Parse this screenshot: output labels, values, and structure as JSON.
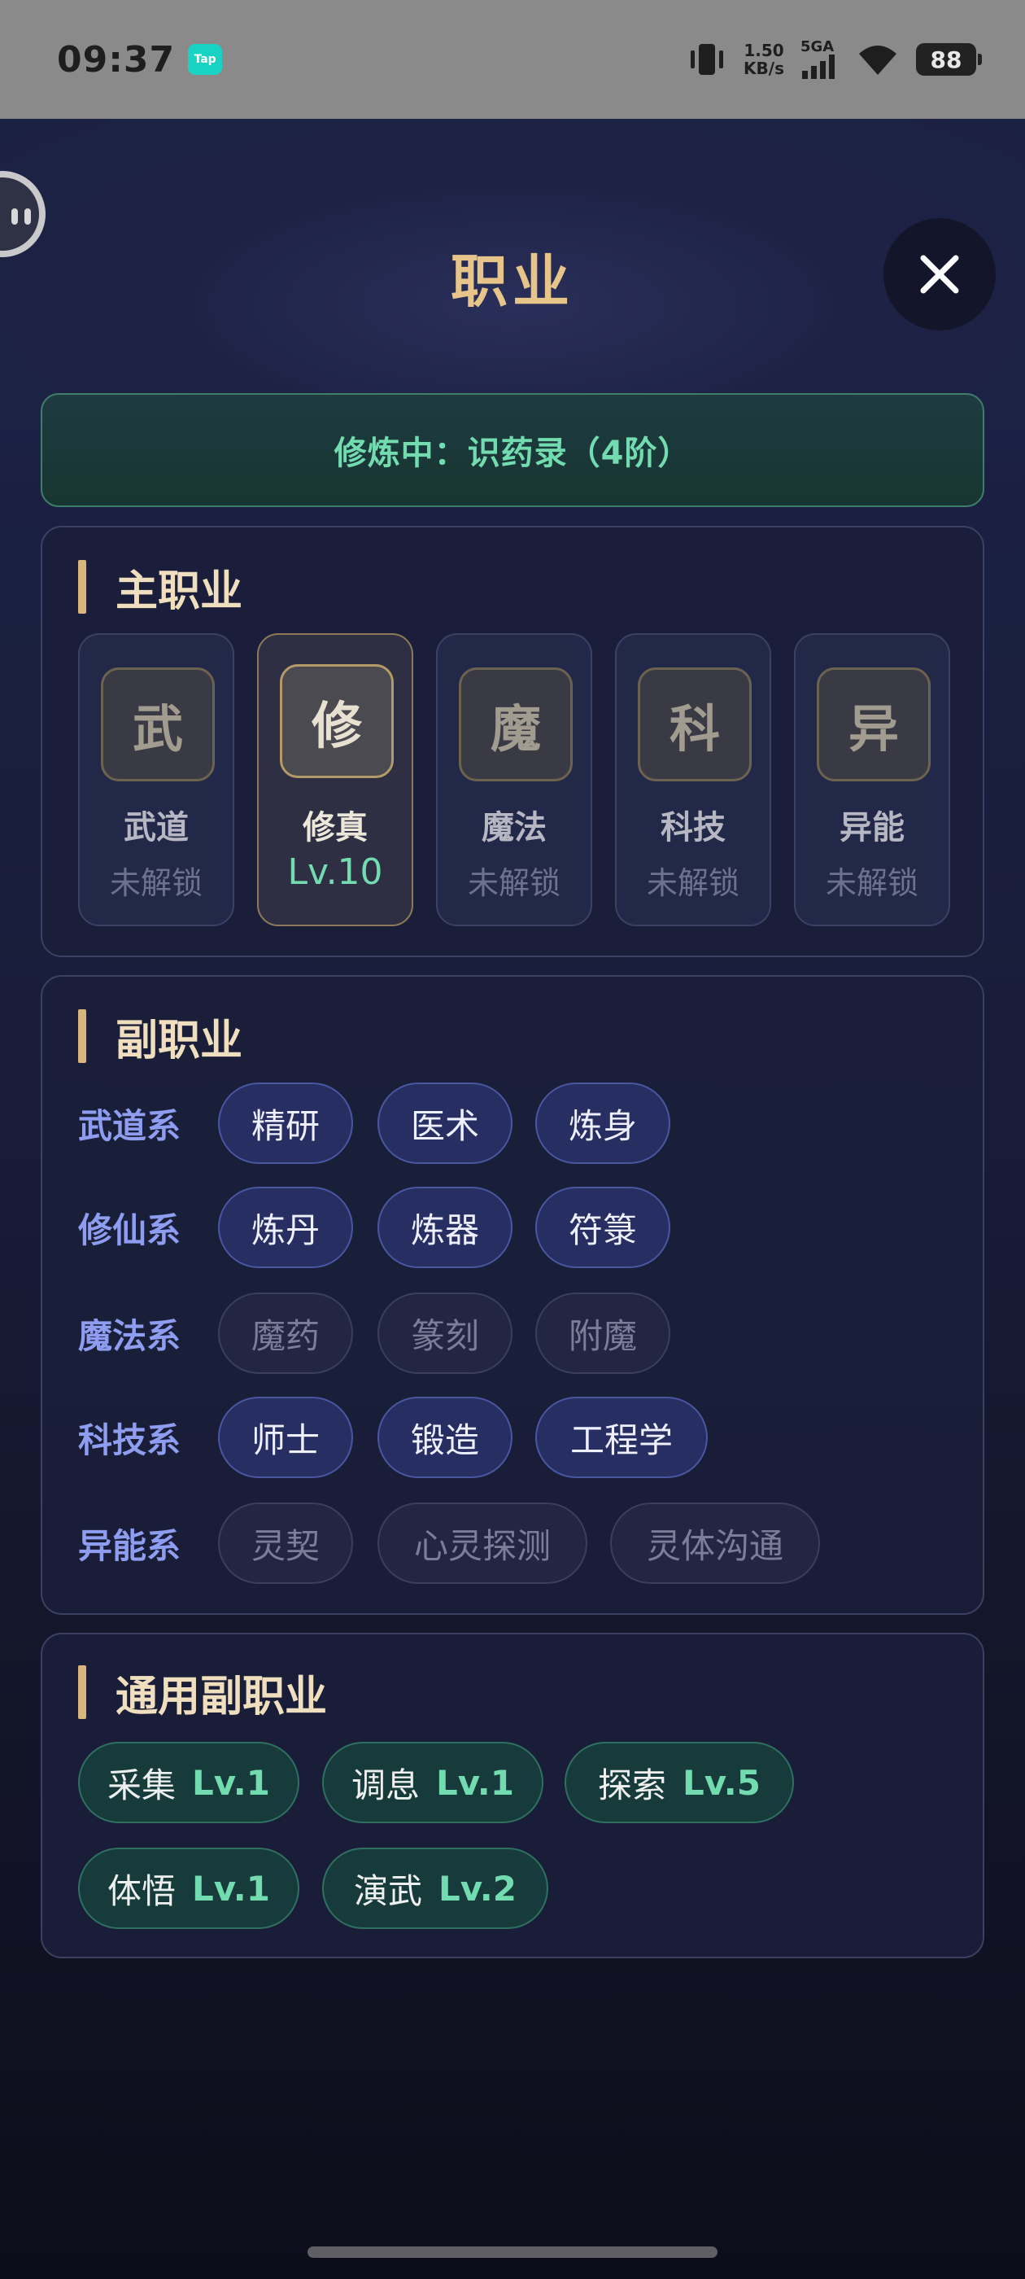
{
  "status_bar": {
    "time": "09:37",
    "app_badge": "Tap",
    "speed_value": "1.50",
    "speed_unit": "KB/s",
    "network": "5GA",
    "battery": "88"
  },
  "header": {
    "title": "职业"
  },
  "banner": {
    "text": "修炼中：识药录（4阶）"
  },
  "main_jobs": {
    "title": "主职业",
    "items": [
      {
        "icon": "武",
        "name": "武道",
        "status": "未解锁",
        "active": false
      },
      {
        "icon": "修",
        "name": "修真",
        "status": "Lv.10",
        "active": true
      },
      {
        "icon": "魔",
        "name": "魔法",
        "status": "未解锁",
        "active": false
      },
      {
        "icon": "科",
        "name": "科技",
        "status": "未解锁",
        "active": false
      },
      {
        "icon": "异",
        "name": "异能",
        "status": "未解锁",
        "active": false
      }
    ]
  },
  "sub_jobs": {
    "title": "副职业",
    "rows": [
      {
        "label": "武道系",
        "items": [
          "精研",
          "医术",
          "炼身"
        ],
        "locked": false
      },
      {
        "label": "修仙系",
        "items": [
          "炼丹",
          "炼器",
          "符箓"
        ],
        "locked": false
      },
      {
        "label": "魔法系",
        "items": [
          "魔药",
          "篆刻",
          "附魔"
        ],
        "locked": true
      },
      {
        "label": "科技系",
        "items": [
          "师士",
          "锻造",
          "工程学"
        ],
        "locked": false
      },
      {
        "label": "异能系",
        "items": [
          "灵契",
          "心灵探测",
          "灵体沟通"
        ],
        "locked": true
      }
    ]
  },
  "general_jobs": {
    "title": "通用副职业",
    "items": [
      {
        "name": "采集",
        "level": "Lv.1"
      },
      {
        "name": "调息",
        "level": "Lv.1"
      },
      {
        "name": "探索",
        "level": "Lv.5"
      },
      {
        "name": "体悟",
        "level": "Lv.1"
      },
      {
        "name": "演武",
        "level": "Lv.2"
      }
    ]
  },
  "colors": {
    "accent_gold": "#e6c48a",
    "accent_green": "#73dbb0",
    "accent_blue": "#8f9df0"
  }
}
